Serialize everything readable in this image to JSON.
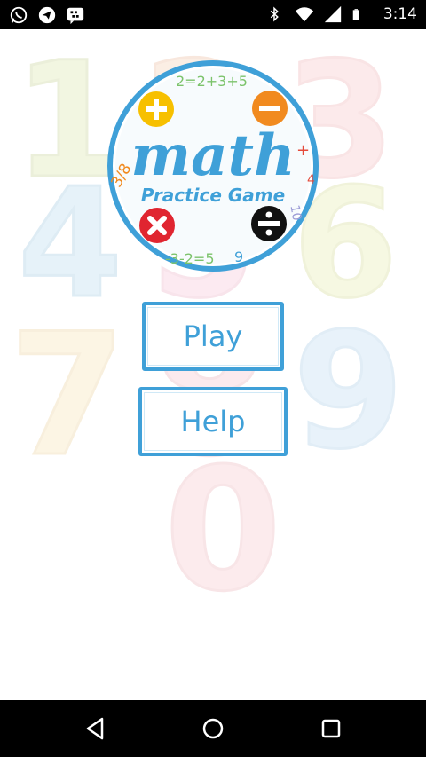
{
  "status_bar": {
    "time": "3:14",
    "left_icons": [
      "whatsapp-icon",
      "telegram-icon",
      "bbm-icon"
    ],
    "right_icons": [
      "bluetooth-icon",
      "wifi-icon",
      "signal-icon",
      "battery-icon"
    ]
  },
  "background_digits": [
    "1",
    "2",
    "3",
    "4",
    "5",
    "6",
    "7",
    "8",
    "9",
    "0"
  ],
  "logo": {
    "title": "math",
    "subtitle": "Practice Game",
    "doodles": [
      "2=2+3+5",
      "+",
      "3/8",
      "-3-2=5",
      "9",
      "4",
      "10"
    ],
    "operators": [
      "plus-icon",
      "minus-icon",
      "multiply-icon",
      "divide-icon"
    ],
    "colors": {
      "ring": "#3fa0d8",
      "plus": "#f7c000",
      "minus": "#f18a1f",
      "multiply": "#e02530",
      "divide": "#111111"
    }
  },
  "menu": {
    "play_label": "Play",
    "help_label": "Help"
  },
  "nav_bar": {
    "buttons": [
      "back-icon",
      "home-icon",
      "recent-apps-icon"
    ]
  },
  "colors": {
    "accent": "#3fa0d8",
    "status_bar": "#000000",
    "nav_bar": "#000000"
  }
}
